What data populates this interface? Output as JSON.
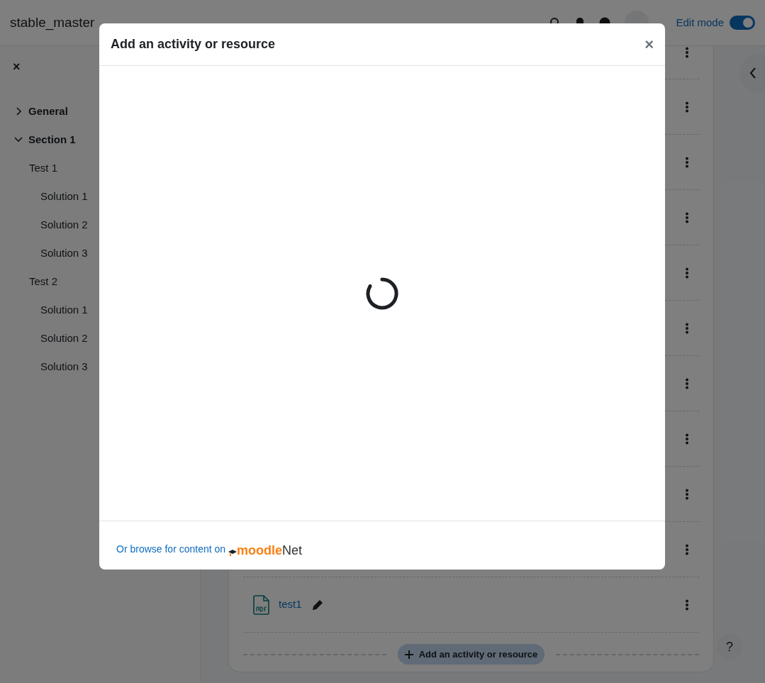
{
  "site_name": "stable_master",
  "edit_mode": {
    "label": "Edit mode",
    "on": true
  },
  "course_index": {
    "close": "×",
    "sections": [
      {
        "label": "General",
        "expanded": false
      },
      {
        "label": "Section 1",
        "expanded": true,
        "children": [
          {
            "label": "Test 1",
            "children": [
              {
                "label": "Solution 1"
              },
              {
                "label": "Solution 2"
              },
              {
                "label": "Solution 3"
              }
            ]
          },
          {
            "label": "Test 2",
            "children": [
              {
                "label": "Solution 1"
              },
              {
                "label": "Solution 2"
              },
              {
                "label": "Solution 3"
              }
            ]
          }
        ]
      }
    ]
  },
  "activity_rows": [
    {
      "kind": "covered"
    },
    {
      "kind": "covered"
    },
    {
      "kind": "covered"
    },
    {
      "kind": "covered"
    },
    {
      "kind": "covered"
    },
    {
      "kind": "covered"
    },
    {
      "kind": "covered"
    },
    {
      "kind": "covered"
    },
    {
      "kind": "covered"
    },
    {
      "kind": "covered"
    },
    {
      "kind": "file",
      "name": "test1"
    }
  ],
  "add_button": "Add an activity or resource",
  "help": "?",
  "modal": {
    "title": "Add an activity or resource",
    "close": "×",
    "loading": true,
    "footer_text": "Or browse for content on",
    "logo": [
      "moodle",
      "Net"
    ]
  }
}
